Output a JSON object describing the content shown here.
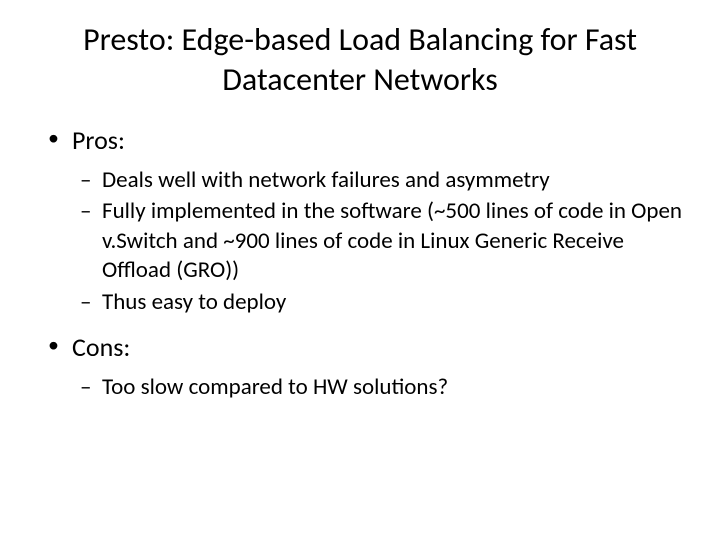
{
  "title": "Presto: Edge-based Load Balancing for Fast Datacenter Networks",
  "pros": {
    "label": "Pros:",
    "items": [
      "Deals well with network failures and asymmetry",
      "Fully implemented in the software (~500 lines of code in Open v.Switch and ~900 lines of code in Linux Generic Receive Offload (GRO))",
      "Thus easy to deploy"
    ]
  },
  "cons": {
    "label": "Cons:",
    "items": [
      "Too slow compared to HW solutions?"
    ]
  }
}
